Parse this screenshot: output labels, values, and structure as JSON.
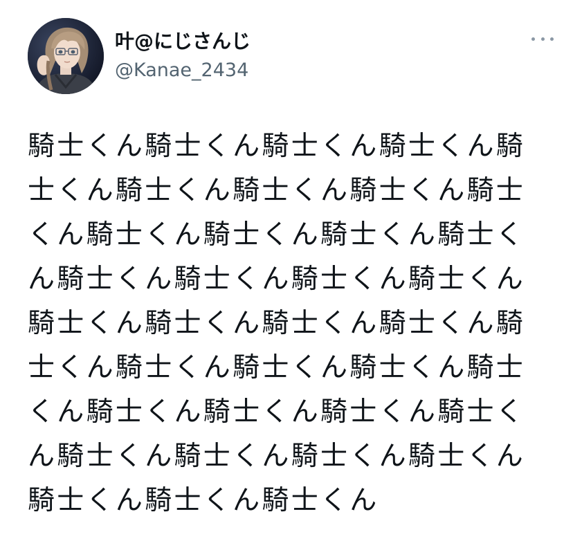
{
  "author": {
    "display_name": "叶@にじさんじ",
    "handle": "@Kanae_2434",
    "avatar_icon": "avatar-illustration"
  },
  "menu": {
    "icon": "more-options-icon"
  },
  "tweet": {
    "text": "騎士くん騎士くん騎士くん騎士くん騎士くん騎士くん騎士くん騎士くん騎士くん騎士くん騎士くん騎士くん騎士くん騎士くん騎士くん騎士くん騎士くん騎士くん騎士くん騎士くん騎士くん騎士くん騎士くん騎士くん騎士くん騎士くん騎士くん騎士くん騎士くん騎士くん騎士くん騎士くん騎士くん騎士くん騎士くん騎士くん騎士くん"
  },
  "colors": {
    "text": "#0f1419",
    "secondary_text": "#536471",
    "menu_dots": "#8b98a5",
    "background": "#ffffff"
  }
}
